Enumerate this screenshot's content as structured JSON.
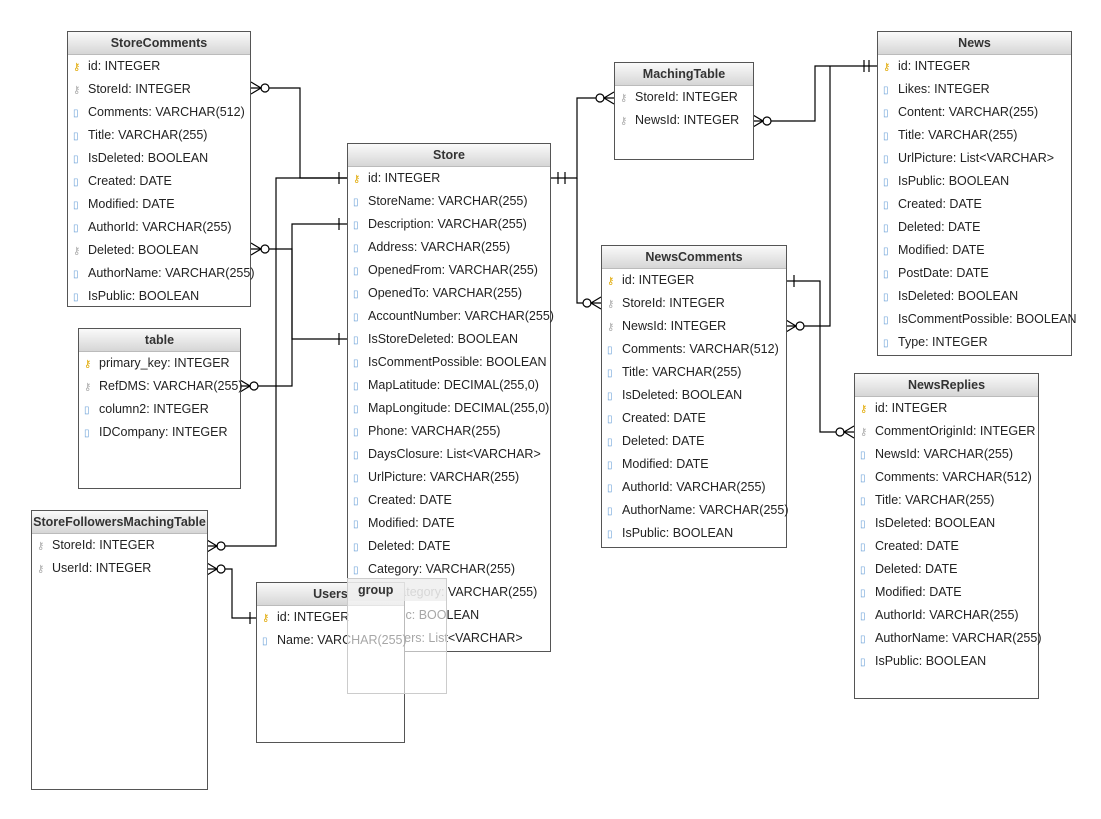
{
  "tables": [
    {
      "name": "StoreComments",
      "rows": [
        [
          "pk",
          "id: INTEGER"
        ],
        [
          "fk",
          "StoreId: INTEGER"
        ],
        [
          "col",
          "Comments: VARCHAR(512)"
        ],
        [
          "col",
          "Title: VARCHAR(255)"
        ],
        [
          "col",
          "IsDeleted: BOOLEAN"
        ],
        [
          "col",
          "Created: DATE"
        ],
        [
          "col",
          "Modified: DATE"
        ],
        [
          "col",
          "AuthorId: VARCHAR(255)"
        ],
        [
          "fk",
          "Deleted: BOOLEAN"
        ],
        [
          "col",
          "AuthorName: VARCHAR(255)"
        ],
        [
          "col",
          "IsPublic: BOOLEAN"
        ]
      ]
    },
    {
      "name": "Store",
      "rows": [
        [
          "pk",
          "id: INTEGER"
        ],
        [
          "col",
          "StoreName: VARCHAR(255)"
        ],
        [
          "col",
          "Description: VARCHAR(255)"
        ],
        [
          "col",
          "Address: VARCHAR(255)"
        ],
        [
          "col",
          "OpenedFrom: VARCHAR(255)"
        ],
        [
          "col",
          "OpenedTo: VARCHAR(255)"
        ],
        [
          "col",
          "AccountNumber: VARCHAR(255)"
        ],
        [
          "col",
          "IsStoreDeleted: BOOLEAN"
        ],
        [
          "col",
          "IsCommentPossible: BOOLEAN"
        ],
        [
          "col",
          "MapLatitude: DECIMAL(255,0)"
        ],
        [
          "col",
          "MapLongitude: DECIMAL(255,0)"
        ],
        [
          "col",
          "Phone: VARCHAR(255)"
        ],
        [
          "col",
          "DaysClosure: List<VARCHAR>"
        ],
        [
          "col",
          "UrlPicture: VARCHAR(255)"
        ],
        [
          "col",
          "Created: DATE"
        ],
        [
          "col",
          "Modified: DATE"
        ],
        [
          "col",
          "Deleted: DATE"
        ],
        [
          "col",
          "Category: VARCHAR(255)"
        ],
        [
          "col",
          "SubCategory: VARCHAR(255)"
        ],
        [
          "col",
          "IsPublic: BOOLEAN"
        ],
        [
          "col",
          "Followers: List<VARCHAR>"
        ]
      ]
    },
    {
      "name": "MachingTable",
      "rows": [
        [
          "fk",
          "StoreId: INTEGER"
        ],
        [
          "fk",
          "NewsId: INTEGER"
        ]
      ]
    },
    {
      "name": "News",
      "rows": [
        [
          "pk",
          "id: INTEGER"
        ],
        [
          "col",
          "Likes: INTEGER"
        ],
        [
          "col",
          "Content: VARCHAR(255)"
        ],
        [
          "col",
          "Title: VARCHAR(255)"
        ],
        [
          "col",
          "UrlPicture: List<VARCHAR>"
        ],
        [
          "col",
          "IsPublic: BOOLEAN"
        ],
        [
          "col",
          "Created: DATE"
        ],
        [
          "col",
          "Deleted: DATE"
        ],
        [
          "col",
          "Modified: DATE"
        ],
        [
          "col",
          "PostDate: DATE"
        ],
        [
          "col",
          "IsDeleted: BOOLEAN"
        ],
        [
          "col",
          "IsCommentPossible: BOOLEAN"
        ],
        [
          "col",
          "Type: INTEGER"
        ]
      ]
    },
    {
      "name": "NewsComments",
      "rows": [
        [
          "pk",
          "id: INTEGER"
        ],
        [
          "fk",
          "StoreId: INTEGER"
        ],
        [
          "fk",
          "NewsId: INTEGER"
        ],
        [
          "col",
          "Comments: VARCHAR(512)"
        ],
        [
          "col",
          "Title: VARCHAR(255)"
        ],
        [
          "col",
          "IsDeleted: BOOLEAN"
        ],
        [
          "col",
          "Created: DATE"
        ],
        [
          "col",
          "Deleted: DATE"
        ],
        [
          "col",
          "Modified: DATE"
        ],
        [
          "col",
          "AuthorId: VARCHAR(255)"
        ],
        [
          "col",
          "AuthorName: VARCHAR(255)"
        ],
        [
          "col",
          "IsPublic: BOOLEAN"
        ]
      ]
    },
    {
      "name": "NewsReplies",
      "rows": [
        [
          "pk",
          "id: INTEGER"
        ],
        [
          "fk",
          "CommentOriginId: INTEGER"
        ],
        [
          "col",
          "NewsId: VARCHAR(255)"
        ],
        [
          "col",
          "Comments: VARCHAR(512)"
        ],
        [
          "col",
          "Title: VARCHAR(255)"
        ],
        [
          "col",
          "IsDeleted: BOOLEAN"
        ],
        [
          "col",
          "Created: DATE"
        ],
        [
          "col",
          "Deleted: DATE"
        ],
        [
          "col",
          "Modified: DATE"
        ],
        [
          "col",
          "AuthorId: VARCHAR(255)"
        ],
        [
          "col",
          "AuthorName: VARCHAR(255)"
        ],
        [
          "col",
          "IsPublic: BOOLEAN"
        ]
      ]
    },
    {
      "name": "table",
      "rows": [
        [
          "pk",
          "primary_key: INTEGER"
        ],
        [
          "fk",
          "RefDMS: VARCHAR(255)"
        ],
        [
          "col",
          "column2: INTEGER"
        ],
        [
          "col",
          "IDCompany: INTEGER"
        ]
      ]
    },
    {
      "name": "StoreFollowersMachingTable",
      "rows": [
        [
          "fk",
          "StoreId: INTEGER"
        ],
        [
          "fk",
          "UserId: INTEGER"
        ]
      ]
    },
    {
      "name": "Users",
      "rows": [
        [
          "pk",
          "id: INTEGER"
        ],
        [
          "col",
          "Name: VARCHAR(255)"
        ]
      ]
    }
  ],
  "group": {
    "label": "group"
  }
}
